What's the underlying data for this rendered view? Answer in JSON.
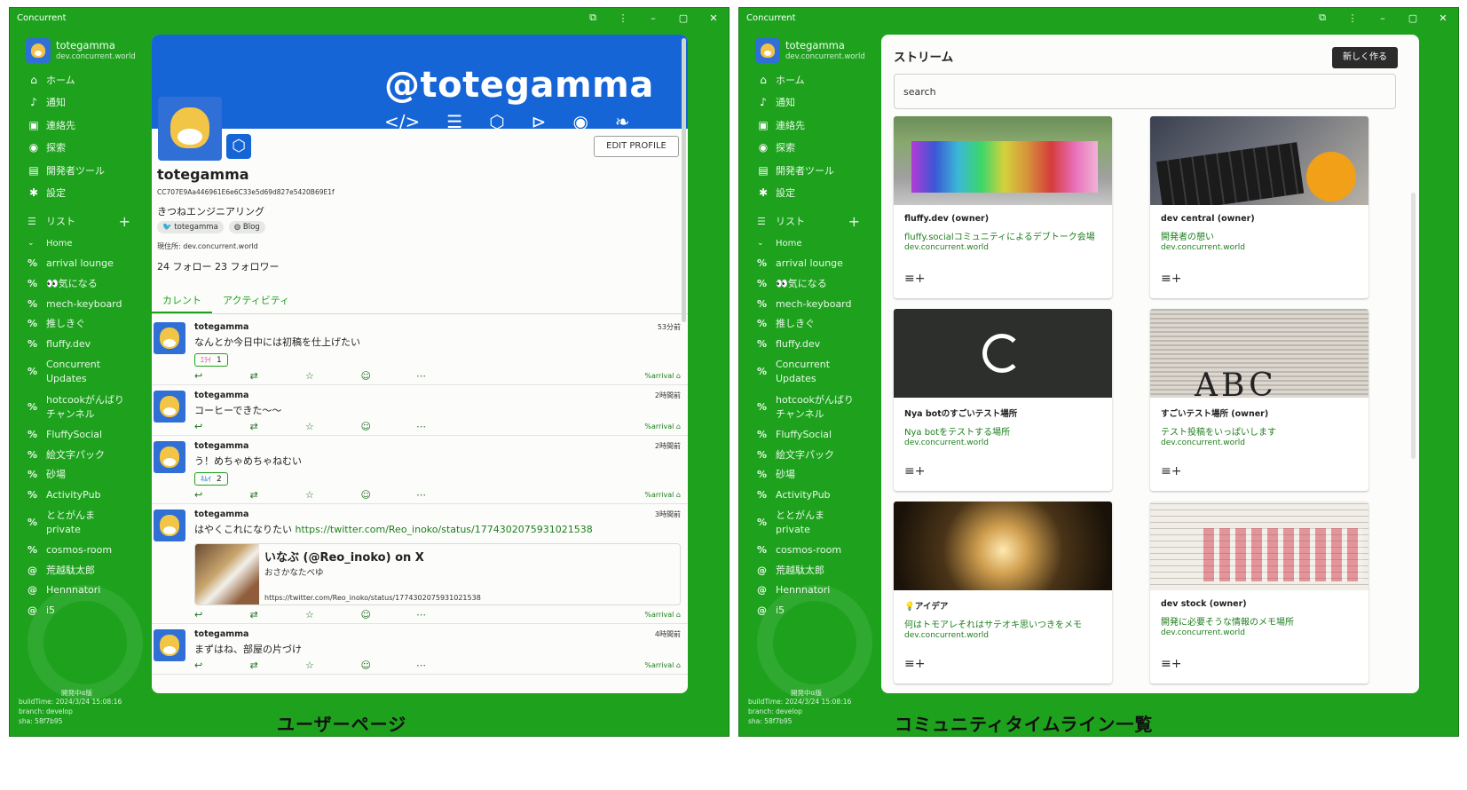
{
  "left_window": {
    "title": "Concurrent",
    "caption": "ユーザーページ",
    "sidebar": {
      "user": {
        "name": "totegamma",
        "host": "dev.concurrent.world"
      },
      "menu": [
        {
          "icon": "home-icon",
          "glyph": "⌂",
          "label": "ホーム"
        },
        {
          "icon": "bell-icon",
          "glyph": "♪",
          "label": "通知"
        },
        {
          "icon": "contacts-icon",
          "glyph": "▣",
          "label": "連絡先"
        },
        {
          "icon": "compass-icon",
          "glyph": "◉",
          "label": "探索"
        },
        {
          "icon": "terminal-icon",
          "glyph": "▤",
          "label": "開発者ツール"
        },
        {
          "icon": "gear-icon",
          "glyph": "✱",
          "label": "設定"
        }
      ],
      "list_header": "リスト",
      "sub_header": "Home",
      "streams": [
        {
          "icon": "%",
          "label": "arrival lounge"
        },
        {
          "icon": "%",
          "label": "👀気になる"
        },
        {
          "icon": "%",
          "label": "mech-keyboard"
        },
        {
          "icon": "%",
          "label": "推しきぐ"
        },
        {
          "icon": "%",
          "label": "fluffy.dev"
        },
        {
          "icon": "%",
          "label": "Concurrent Updates"
        },
        {
          "icon": "%",
          "label": "hotcookがんばりチャンネル"
        },
        {
          "icon": "%",
          "label": "FluffySocial"
        },
        {
          "icon": "%",
          "label": "絵文字パック"
        },
        {
          "icon": "%",
          "label": "砂場"
        },
        {
          "icon": "%",
          "label": "ActivityPub"
        },
        {
          "icon": "%",
          "label": "ととがんま private"
        },
        {
          "icon": "%",
          "label": "cosmos-room"
        },
        {
          "icon": "@",
          "label": "荒越駄太郎"
        },
        {
          "icon": "@",
          "label": "Hennnatori"
        },
        {
          "icon": "@",
          "label": "i5"
        }
      ],
      "build": {
        "label": "開発中α版",
        "time": "buildTime: 2024/3/24 15:08:16",
        "branch": "branch: develop",
        "sha": "sha: 58f7b95"
      }
    },
    "profile": {
      "banner_text": "@totegamma",
      "edit_label": "EDIT PROFILE",
      "name": "totegamma",
      "hash": "CC707E9Aa446961E6e6C33e5d69d827e5420B69E1f",
      "bio": "きつねエンジニアリング",
      "chips": [
        "totegamma",
        "Blog"
      ],
      "location": "現住所: dev.concurrent.world",
      "follow": "24 フォロー  23 フォロワー",
      "tabs": [
        "カレント",
        "アクティビティ"
      ]
    },
    "posts": [
      {
        "author": "totegamma",
        "time": "53分前",
        "text": "なんとか今日中には初稿を仕上げたい",
        "reaction": {
          "emoji": "ｴﾗｲ",
          "count": "1"
        },
        "tag": "%arrival"
      },
      {
        "author": "totegamma",
        "time": "2時間前",
        "text": "コーヒーできた〜〜",
        "tag": "%arrival"
      },
      {
        "author": "totegamma",
        "time": "2時間前",
        "text": "う！めちゃめちゃねむい",
        "reaction": {
          "emoji": "ﾈﾑｲ",
          "count": "2"
        },
        "tag": "%arrival"
      },
      {
        "author": "totegamma",
        "time": "3時間前",
        "text": "はやくこれになりたい",
        "link": "https://twitter.com/Reo_inoko/status/1774302075931021538",
        "embed": {
          "title": "いなぶ (@Reo_inoko) on X",
          "sub": "おさかなたべゆ",
          "url": "https://twitter.com/Reo_inoko/status/1774302075931021538"
        },
        "tag": "%arrival"
      },
      {
        "author": "totegamma",
        "time": "4時間前",
        "text": "まずはね、部屋の片づけ",
        "tag": "%arrival"
      }
    ]
  },
  "right_window": {
    "title": "Concurrent",
    "caption": "コミュニティタイムライン一覧",
    "stream_title": "ストリーム",
    "new_button": "新しく作る",
    "search_placeholder": "search",
    "cards": [
      {
        "name": "fluffy.dev (owner)",
        "desc": "fluffy.socialコミュニティによるデブトーク会場",
        "host": "dev.concurrent.world"
      },
      {
        "name": "dev central (owner)",
        "desc": "開発者の憩い",
        "host": "dev.concurrent.world"
      },
      {
        "name": "Nya botのすごいテスト場所",
        "desc": "Nya botをテストする場所",
        "host": "dev.concurrent.world"
      },
      {
        "name": "すごいテスト場所 (owner)",
        "desc": "テスト投稿をいっぱいします",
        "host": "dev.concurrent.world"
      },
      {
        "name": "💡アイデア",
        "desc": "何はトモアレそれはサテオキ思いつきをメモ",
        "host": "dev.concurrent.world"
      },
      {
        "name": "dev stock (owner)",
        "desc": "開発に必要そうな情報のメモ場所",
        "host": "dev.concurrent.world"
      }
    ]
  },
  "colors": {
    "accent": "#1ea21e",
    "banner": "#1565d6",
    "link": "#1d7f1d"
  }
}
